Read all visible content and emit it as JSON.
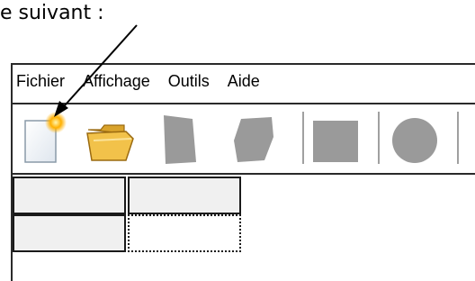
{
  "caption": {
    "text": "e suivant :"
  },
  "menu": {
    "items": [
      {
        "label": "Fichier"
      },
      {
        "label": "Affichage"
      },
      {
        "label": "Outils"
      },
      {
        "label": "Aide"
      }
    ]
  },
  "toolbar": {
    "buttons": [
      {
        "icon": "new-document-icon",
        "state": "enabled"
      },
      {
        "icon": "open-folder-icon",
        "state": "enabled"
      },
      {
        "icon": "shape-tool-1-icon",
        "state": "disabled"
      },
      {
        "icon": "shape-tool-2-icon",
        "state": "disabled"
      },
      {
        "icon": "rectangle-tool-icon",
        "state": "disabled"
      },
      {
        "icon": "circle-tool-icon",
        "state": "disabled"
      }
    ]
  },
  "colors": {
    "disabled_icon": "#9a9a9a",
    "folder": "#f2c24a",
    "cell_bg": "#f0f0f0",
    "glow": "#ffb000"
  }
}
